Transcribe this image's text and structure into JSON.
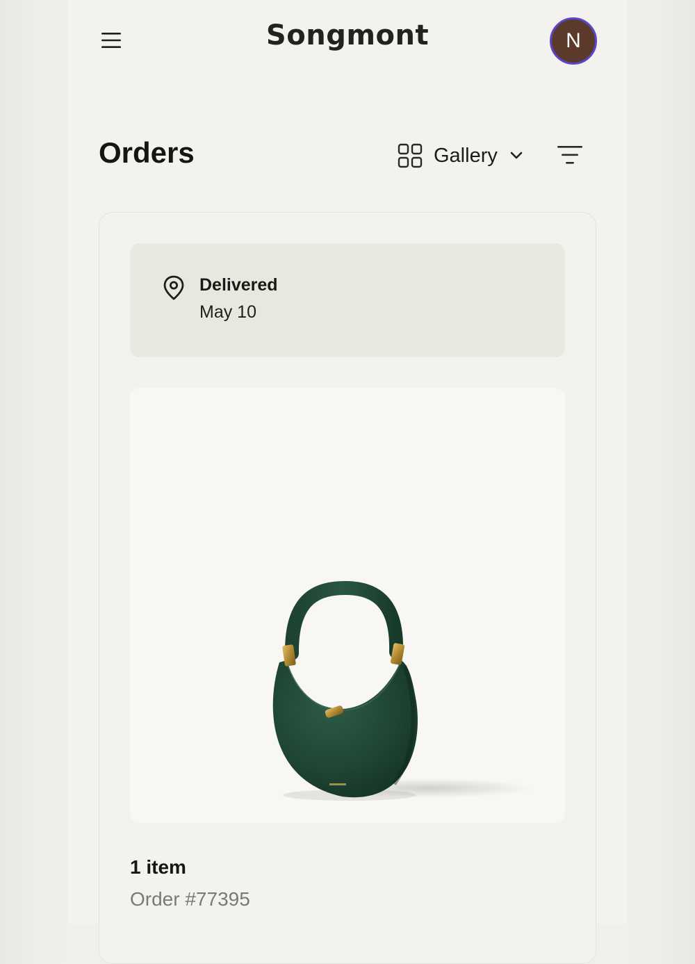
{
  "header": {
    "brand": "Songmont",
    "avatar_initial": "N",
    "avatar_color": "#5b3a2c",
    "avatar_ring_color": "#5a46c8",
    "menu_icon": "hamburger-menu-icon"
  },
  "orders_page": {
    "title": "Orders",
    "view_selector": {
      "icon": "grid-view-icon",
      "selected": "Gallery",
      "dropdown_icon": "chevron-down-icon"
    },
    "filter_icon": "filter-icon"
  },
  "order": {
    "status_icon": "location-pin-icon",
    "status": "Delivered",
    "status_date": "May 10",
    "product_image": "green-leather-crescent-handbag",
    "product_brand_stamp": "songmont",
    "item_count": "1 item",
    "order_number": "Order #77395"
  }
}
